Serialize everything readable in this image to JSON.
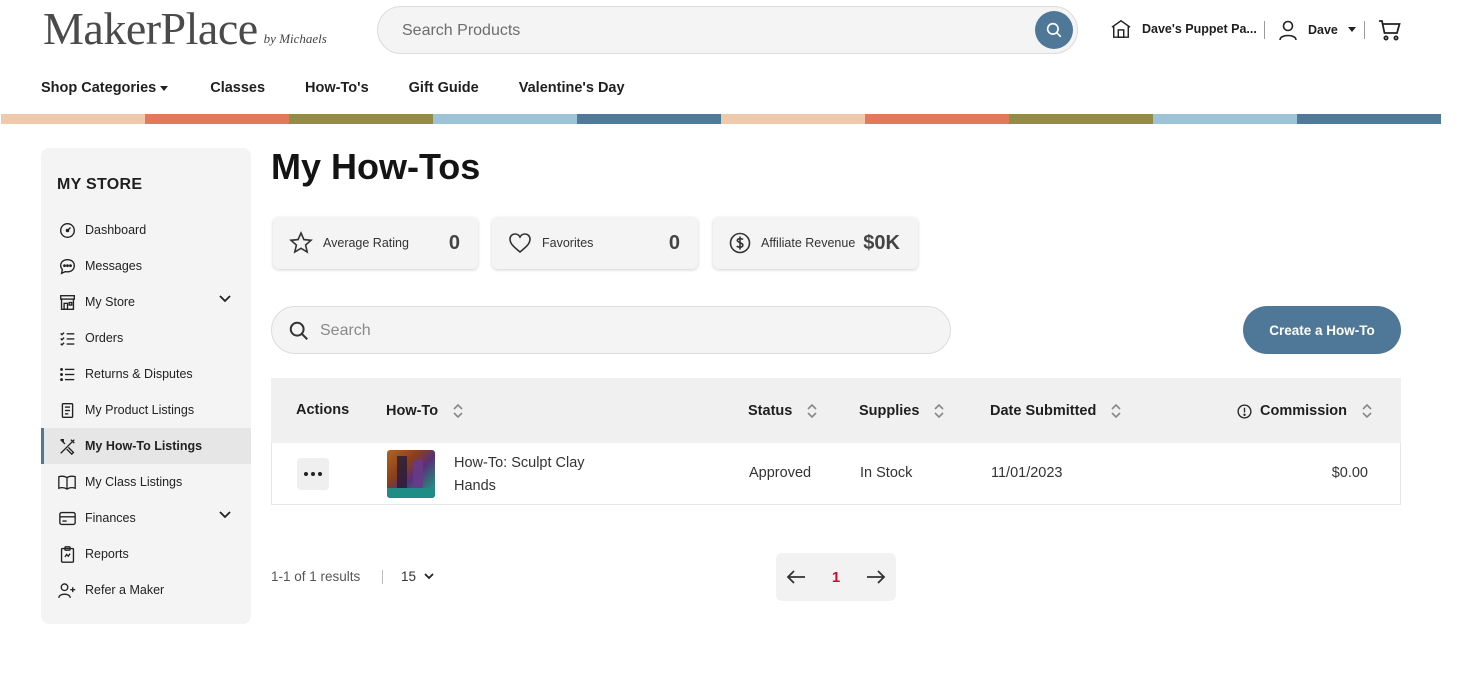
{
  "header": {
    "logo_main": "MakerPlace",
    "logo_by": "by Michaels",
    "search_placeholder": "Search Products",
    "shop_name": "Dave's Puppet Pa...",
    "user_name": "Dave",
    "icons": [
      "search-icon",
      "store-icon",
      "user-icon",
      "chevron-down-icon",
      "cart-icon"
    ]
  },
  "nav": {
    "items": [
      "Shop Categories",
      "Classes",
      "How-To's",
      "Gift Guide",
      "Valentine's Day"
    ]
  },
  "stripe_colors": [
    "#efc9ac",
    "#e07a57",
    "#948b45",
    "#9dc3d6",
    "#4f7a9a",
    "#efc9ac",
    "#e07a57",
    "#948b45",
    "#9dc3d6",
    "#4f7a9a"
  ],
  "sidebar": {
    "title": "MY STORE",
    "items": [
      {
        "label": "Dashboard",
        "icon": "gauge-icon"
      },
      {
        "label": "Messages",
        "icon": "chat-icon"
      },
      {
        "label": "My Store",
        "icon": "storefront-icon"
      },
      {
        "label": "Orders",
        "icon": "checklist-icon"
      },
      {
        "label": "Returns & Disputes",
        "icon": "list-icon"
      },
      {
        "label": "My Product Listings",
        "icon": "document-icon"
      },
      {
        "label": "My How-To Listings",
        "icon": "tools-icon"
      },
      {
        "label": "My Class Listings",
        "icon": "book-icon"
      },
      {
        "label": "Finances",
        "icon": "card-icon"
      },
      {
        "label": "Reports",
        "icon": "clipboard-icon"
      },
      {
        "label": "Refer a Maker",
        "icon": "add-user-icon"
      }
    ]
  },
  "main": {
    "title": "My How-Tos",
    "stats": [
      {
        "label": "Average Rating",
        "value": "0",
        "icon": "star-icon"
      },
      {
        "label": "Favorites",
        "value": "0",
        "icon": "heart-icon"
      },
      {
        "label": "Affiliate Revenue",
        "value": "$0K",
        "icon": "dollar-icon"
      }
    ],
    "search_placeholder": "Search",
    "create_button": "Create a How-To"
  },
  "table": {
    "columns": [
      "Actions",
      "How-To",
      "Status",
      "Supplies",
      "Date Submitted",
      "Commission"
    ],
    "rows": [
      {
        "title_line1": "How-To: Sculpt Clay",
        "title_line2": "Hands",
        "status": "Approved",
        "supplies": "In Stock",
        "date": "11/01/2023",
        "commission": "$0.00"
      }
    ]
  },
  "pagination": {
    "results": "1-1 of 1 results",
    "per_page": "15",
    "current_page": "1"
  },
  "colors": {
    "accent": "#4f7797",
    "page_number": "#c8102e",
    "panel": "#f4f4f4"
  }
}
